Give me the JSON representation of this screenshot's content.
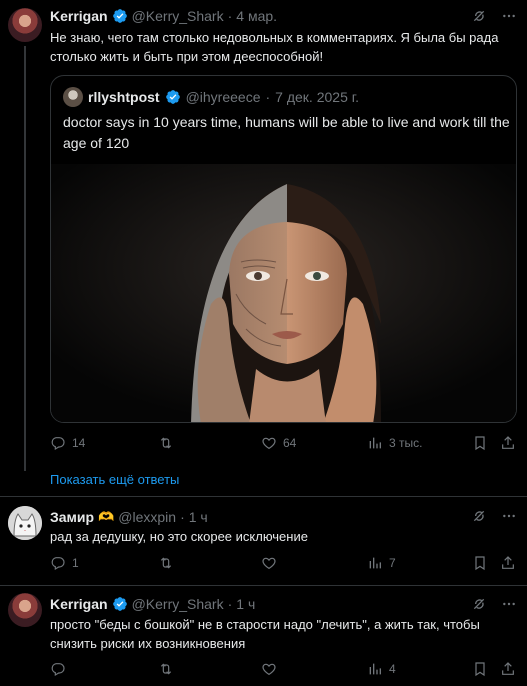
{
  "post1": {
    "name": "Kerrigan",
    "handle": "@Kerry_Shark",
    "sep": "·",
    "time": "4 мар.",
    "text": "Не знаю, чего там столько недовольных в комментариях. Я была бы рада столько жить и быть при этом дееспособной!",
    "quote": {
      "name": "rllyshtpost",
      "handle": "@ihyreeece",
      "sep": "·",
      "time": "7 дек. 2025 г.",
      "text": "doctor says in 10 years time, humans will be able to live and work till the age of 120"
    },
    "stats": {
      "replies": "14",
      "reposts": "",
      "likes": "64",
      "views": "3 тыс."
    }
  },
  "show_more": "Показать ещё ответы",
  "post2": {
    "name": "Замир",
    "emoji": "🫶",
    "handle": "@lexxpin",
    "sep": "·",
    "time": "1 ч",
    "text": "рад за дедушку, но это скорее исключение",
    "stats": {
      "replies": "1",
      "reposts": "",
      "likes": "",
      "views": "7"
    }
  },
  "post3": {
    "name": "Kerrigan",
    "handle": "@Kerry_Shark",
    "sep": "·",
    "time": "1 ч",
    "text": "просто \"беды с бошкой\" не в старости надо \"лечить\", а жить так, чтобы снизить риски их возникновения",
    "stats": {
      "replies": "",
      "reposts": "",
      "likes": "",
      "views": "4"
    }
  },
  "colors": {
    "accent": "#1d9bf0",
    "muted": "#71767b",
    "text": "#e7e9ea",
    "background": "#000000",
    "border": "#2f3336"
  }
}
